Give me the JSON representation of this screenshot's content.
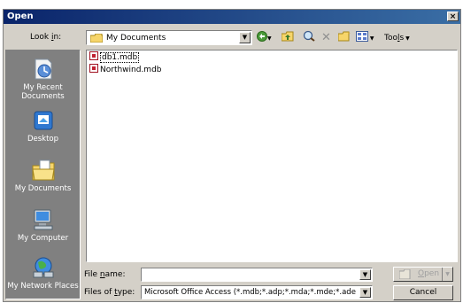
{
  "title": "Open",
  "close_glyph": "×",
  "look_in": {
    "label_pre": "Look ",
    "label_key": "i",
    "label_post": "n:",
    "value": "My Documents"
  },
  "toolbar": {
    "tools_pre": "Too",
    "tools_key": "l",
    "tools_post": "s"
  },
  "places": [
    {
      "label": "My Recent Documents",
      "icon": "recent-documents-icon"
    },
    {
      "label": "Desktop",
      "icon": "desktop-icon"
    },
    {
      "label": "My Documents",
      "icon": "my-documents-icon"
    },
    {
      "label": "My Computer",
      "icon": "my-computer-icon"
    },
    {
      "label": "My Network Places",
      "icon": "network-places-icon"
    }
  ],
  "files": [
    {
      "name": "db1.mdb",
      "selected": true
    },
    {
      "name": "Northwind.mdb",
      "selected": false
    }
  ],
  "file_name": {
    "label_pre": "File ",
    "label_key": "n",
    "label_post": "ame:",
    "value": ""
  },
  "files_of_type": {
    "label_pre": "Files of ",
    "label_key": "t",
    "label_post": "ype:",
    "value": "Microsoft Office Access (*.mdb;*.adp;*.mda;*.mde;*.ade"
  },
  "buttons": {
    "open_pre": "",
    "open_key": "O",
    "open_post": "pen",
    "cancel": "Cancel"
  }
}
